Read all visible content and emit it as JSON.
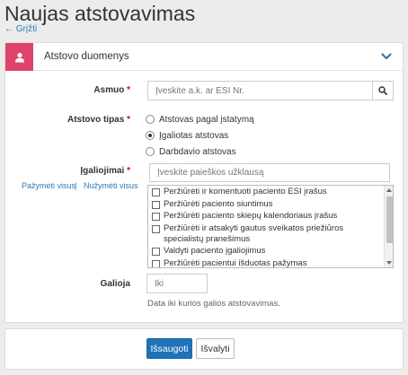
{
  "page": {
    "title": "Naujas atstovavimas",
    "back_label": "← Grįžti"
  },
  "panel": {
    "title": "Atstovo duomenys",
    "icon": "user-icon",
    "accent_color": "#e0446a"
  },
  "form": {
    "person": {
      "label": "Asmuo",
      "required_mark": "*",
      "placeholder": "Įveskite a.k. ar ESI Nr.",
      "value": ""
    },
    "rep_type": {
      "label": "Atstovo tipas",
      "required_mark": "*",
      "options": [
        {
          "label": "Atstovas pagal įstatymą",
          "selected": false
        },
        {
          "label": "Įgaliotas atstovas",
          "selected": true
        },
        {
          "label": "Darbdavio atstovas",
          "selected": false
        }
      ]
    },
    "permissions": {
      "label": "Įgaliojimai",
      "required_mark": "*",
      "search_placeholder": "Įveskite paieškos užklausą",
      "select_all": "Pažymėti visus",
      "separator": "|",
      "deselect_all": "Nužymėti visus",
      "items": [
        {
          "label": "Peržiūrėti ir komentuoti paciento ESI įrašus",
          "checked": false
        },
        {
          "label": "Peržiūrėti paciento siuntimus",
          "checked": false
        },
        {
          "label": "Peržiūrėti paciento skiepų kalendoriaus įrašus",
          "checked": false
        },
        {
          "label": "Peržiūrėti ir atsakyti gautus sveikatos priežiūros specialistų pranešimus",
          "checked": false
        },
        {
          "label": "Valdyti paciento įgaliojimus",
          "checked": false
        },
        {
          "label": "Peržiūrėti pacientui išduotas pažymas",
          "checked": false
        }
      ]
    },
    "valid": {
      "label": "Galioja",
      "placeholder": "Iki",
      "value": "",
      "hint": "Data iki kurios galios atstovavimas."
    }
  },
  "actions": {
    "save_label": "Išsaugoti",
    "cancel_label": "Išvalyti",
    "primary_color": "#1e73b9"
  }
}
